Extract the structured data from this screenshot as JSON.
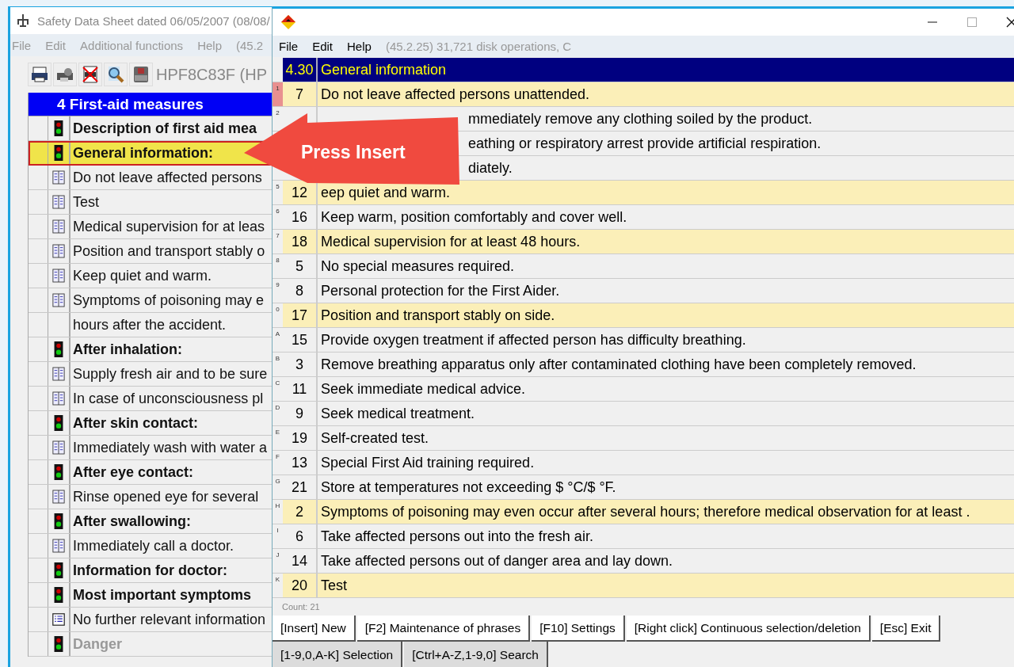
{
  "main_window": {
    "title": "Safety Data Sheet dated 06/05/2007 (08/08/",
    "menu": [
      "File",
      "Edit",
      "Additional functions",
      "Help",
      "(45.2"
    ],
    "printer": "HPF8C83F (HP",
    "section": "4 First-aid measures",
    "rows": [
      {
        "kind": "heading",
        "text": "Description of first aid mea",
        "selected": false
      },
      {
        "kind": "heading",
        "text": "General information:",
        "selected": true
      },
      {
        "kind": "phrase",
        "text": "Do not leave affected persons",
        "selected": false
      },
      {
        "kind": "phrase",
        "text": "Test",
        "selected": false
      },
      {
        "kind": "phrase",
        "text": "Medical supervision for at leas",
        "selected": false
      },
      {
        "kind": "phrase",
        "text": "Position and transport stably o",
        "selected": false
      },
      {
        "kind": "phrase",
        "text": "Keep quiet and warm.",
        "selected": false
      },
      {
        "kind": "phrase",
        "text": "Symptoms of poisoning may e",
        "selected": false
      },
      {
        "kind": "continuation",
        "text": "hours after the accident.",
        "selected": false
      },
      {
        "kind": "heading",
        "text": "After inhalation:",
        "selected": false
      },
      {
        "kind": "phrase",
        "text": "Supply fresh air and to be sure",
        "selected": false
      },
      {
        "kind": "phrase",
        "text": "In case of unconsciousness pl",
        "selected": false
      },
      {
        "kind": "heading",
        "text": "After skin contact:",
        "selected": false
      },
      {
        "kind": "phrase",
        "text": "Immediately wash with water a",
        "selected": false
      },
      {
        "kind": "heading",
        "text": "After eye contact:",
        "selected": false
      },
      {
        "kind": "phrase",
        "text": "Rinse opened eye for several",
        "selected": false
      },
      {
        "kind": "heading",
        "text": "After swallowing:",
        "selected": false
      },
      {
        "kind": "phrase",
        "text": "Immediately call a doctor.",
        "selected": false
      },
      {
        "kind": "heading",
        "text": "Information for doctor:",
        "selected": false
      },
      {
        "kind": "heading",
        "text": "Most important symptoms",
        "selected": false
      },
      {
        "kind": "info",
        "text": "No further relevant information",
        "selected": false
      },
      {
        "kind": "disabled_heading",
        "text": "Danger",
        "selected": false
      }
    ]
  },
  "dialog": {
    "menu": [
      "File",
      "Edit",
      "Help"
    ],
    "status": "(45.2.25) 31,721 disk operations, C",
    "header": {
      "number": "4.30",
      "title": "General information"
    },
    "rows": [
      {
        "key": "1",
        "number": "7",
        "text": "Do not leave affected persons unattended.",
        "selected": true,
        "highlighted": true
      },
      {
        "key": "2",
        "text": "mmediately remove any clothing soiled by the product.",
        "selected": false,
        "highlighted": false
      },
      {
        "text": "eathing or respiratory arrest provide artificial respiration.",
        "selected": false,
        "highlighted": false
      },
      {
        "text": "diately.",
        "selected": false,
        "highlighted": false
      },
      {
        "key": "5",
        "number": "12",
        "text": "eep quiet and warm.",
        "selected": false,
        "highlighted": true
      },
      {
        "key": "6",
        "number": "16",
        "text": "Keep warm, position comfortably and cover well.",
        "selected": false,
        "highlighted": false
      },
      {
        "key": "7",
        "number": "18",
        "text": "Medical supervision for at least 48 hours.",
        "selected": false,
        "highlighted": true
      },
      {
        "key": "8",
        "number": "5",
        "text": "No special measures required.",
        "selected": false,
        "highlighted": false
      },
      {
        "key": "9",
        "number": "8",
        "text": "Personal protection for the First Aider.",
        "selected": false,
        "highlighted": false
      },
      {
        "key": "0",
        "number": "17",
        "text": "Position and transport stably on side.",
        "selected": false,
        "highlighted": true
      },
      {
        "key": "A",
        "number": "15",
        "text": "Provide oxygen treatment if affected person has difficulty breathing.",
        "selected": false,
        "highlighted": false
      },
      {
        "key": "B",
        "number": "3",
        "text": "Remove breathing apparatus only after contaminated clothing have been completely removed.",
        "selected": false,
        "highlighted": false
      },
      {
        "key": "C",
        "number": "11",
        "text": "Seek immediate medical advice.",
        "selected": false,
        "highlighted": false
      },
      {
        "key": "D",
        "number": "9",
        "text": "Seek medical treatment.",
        "selected": false,
        "highlighted": false
      },
      {
        "key": "E",
        "number": "19",
        "text": "Self-created test.",
        "selected": false,
        "highlighted": false
      },
      {
        "key": "F",
        "number": "13",
        "text": "Special First Aid training required.",
        "selected": false,
        "highlighted": false
      },
      {
        "key": "G",
        "number": "21",
        "text": "Store at temperatures not exceeding $ °C/$ °F.",
        "selected": false,
        "highlighted": false
      },
      {
        "key": "H",
        "number": "2",
        "text": "Symptoms of poisoning may even occur after several hours; therefore medical observation for at least .",
        "selected": false,
        "highlighted": true
      },
      {
        "key": "I",
        "number": "6",
        "text": "Take affected persons out into the fresh air.",
        "selected": false,
        "highlighted": false
      },
      {
        "key": "J",
        "number": "14",
        "text": "Take affected persons out of danger area and lay down.",
        "selected": false,
        "highlighted": false
      },
      {
        "key": "K",
        "number": "20",
        "text": "Test",
        "selected": false,
        "highlighted": true
      }
    ],
    "count": "Count: 21",
    "buttons": [
      "[Insert] New",
      "[F2] Maintenance of phrases",
      "[F10] Settings",
      "[Right click] Continuous selection/deletion",
      "[Esc] Exit"
    ],
    "buttons_2": [
      "[1-9,0,A-K] Selection",
      "[Ctrl+A-Z,1-9,0] Search"
    ]
  },
  "callout": {
    "text": "Press Insert"
  }
}
